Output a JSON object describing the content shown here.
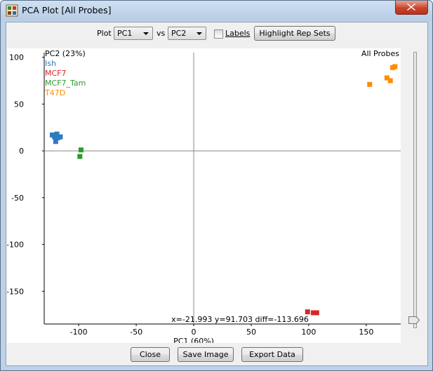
{
  "window": {
    "title": "PCA Plot [All Probes]"
  },
  "toolbar": {
    "plot_label": "Plot",
    "x_pc": "PC1",
    "vs_label": "vs",
    "y_pc": "PC2",
    "labels_checkbox": "Labels",
    "labels_checked": false,
    "highlight_button": "Highlight Rep Sets"
  },
  "plot": {
    "probe_set_label": "All Probes",
    "status_readout": "x=-21.993 y=91.703 diff=-113.696",
    "legend_title": "PC2 (23%)",
    "legend": [
      {
        "name": "Ish",
        "color": "#2b7bbf"
      },
      {
        "name": "MCF7",
        "color": "#d62728"
      },
      {
        "name": "MCF7_Tam",
        "color": "#2e9a2e"
      },
      {
        "name": "T47D",
        "color": "#ff8c00"
      }
    ]
  },
  "chart_data": {
    "type": "scatter",
    "xlabel": "PC1 (60%)",
    "ylabel": "PC2 (23%)",
    "xlim": [
      -130,
      180
    ],
    "ylim": [
      -185,
      105
    ],
    "x_ticks": [
      -100,
      -50,
      0,
      50,
      100,
      150
    ],
    "y_ticks": [
      100,
      50,
      0,
      -50,
      -100,
      -150
    ],
    "series": [
      {
        "name": "Ish",
        "color": "#2b7bbf",
        "points": [
          [
            -123,
            17
          ],
          [
            -119,
            18
          ],
          [
            -116,
            15
          ],
          [
            -121,
            15
          ],
          [
            -118,
            14
          ],
          [
            -120,
            10
          ]
        ]
      },
      {
        "name": "MCF7",
        "color": "#d62728",
        "points": [
          [
            99,
            -172
          ],
          [
            104,
            -173
          ],
          [
            107,
            -173
          ]
        ]
      },
      {
        "name": "MCF7_Tam",
        "color": "#2e9a2e",
        "points": [
          [
            -98,
            1
          ],
          [
            -99,
            -6
          ]
        ]
      },
      {
        "name": "T47D",
        "color": "#ff8c00",
        "points": [
          [
            173,
            89
          ],
          [
            175,
            90
          ],
          [
            168,
            78
          ],
          [
            171,
            75
          ],
          [
            153,
            71
          ]
        ]
      }
    ],
    "grid": false
  },
  "footer": {
    "close": "Close",
    "save_image": "Save Image",
    "export_data": "Export Data"
  }
}
